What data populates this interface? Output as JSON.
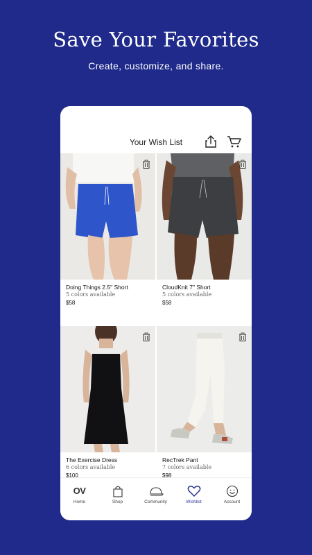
{
  "headline": "Save Your Favorites",
  "subline": "Create, customize, and share.",
  "screen": {
    "title": "Your Wish List",
    "share_icon": "share-icon",
    "cart_icon": "cart-icon"
  },
  "products": [
    {
      "name": "Doing Things 2.5\" Short",
      "colors": "5 colors available",
      "price": "$58"
    },
    {
      "name": "CloudKnit 7\" Short",
      "colors": "5 colors available",
      "price": "$58"
    },
    {
      "name": "The Exercise Dress",
      "colors": "6 colors available",
      "price": "$100"
    },
    {
      "name": "RecTrek Pant",
      "colors": "7 colors available",
      "price": "$98"
    }
  ],
  "tabs": [
    {
      "label": "Home",
      "icon": "ov-logo-icon"
    },
    {
      "label": "Shop",
      "icon": "shopping-bag-icon"
    },
    {
      "label": "Community",
      "icon": "cap-icon"
    },
    {
      "label": "Wishlist",
      "icon": "heart-icon"
    },
    {
      "label": "Account",
      "icon": "smiley-icon"
    }
  ],
  "tab_home_logo": "OV",
  "colors": {
    "background": "#1f2a8a",
    "accent": "#2a3390"
  }
}
